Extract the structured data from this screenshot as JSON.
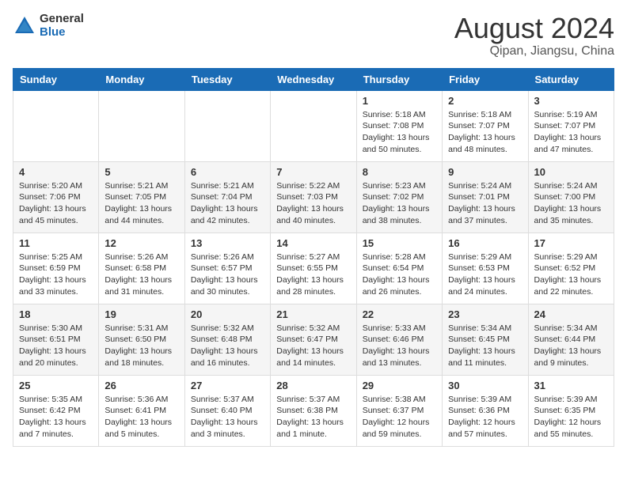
{
  "logo": {
    "general": "General",
    "blue": "Blue"
  },
  "title": {
    "month_year": "August 2024",
    "location": "Qipan, Jiangsu, China"
  },
  "days_of_week": [
    "Sunday",
    "Monday",
    "Tuesday",
    "Wednesday",
    "Thursday",
    "Friday",
    "Saturday"
  ],
  "weeks": [
    [
      {
        "day": "",
        "info": ""
      },
      {
        "day": "",
        "info": ""
      },
      {
        "day": "",
        "info": ""
      },
      {
        "day": "",
        "info": ""
      },
      {
        "day": "1",
        "info": "Sunrise: 5:18 AM\nSunset: 7:08 PM\nDaylight: 13 hours\nand 50 minutes."
      },
      {
        "day": "2",
        "info": "Sunrise: 5:18 AM\nSunset: 7:07 PM\nDaylight: 13 hours\nand 48 minutes."
      },
      {
        "day": "3",
        "info": "Sunrise: 5:19 AM\nSunset: 7:07 PM\nDaylight: 13 hours\nand 47 minutes."
      }
    ],
    [
      {
        "day": "4",
        "info": "Sunrise: 5:20 AM\nSunset: 7:06 PM\nDaylight: 13 hours\nand 45 minutes."
      },
      {
        "day": "5",
        "info": "Sunrise: 5:21 AM\nSunset: 7:05 PM\nDaylight: 13 hours\nand 44 minutes."
      },
      {
        "day": "6",
        "info": "Sunrise: 5:21 AM\nSunset: 7:04 PM\nDaylight: 13 hours\nand 42 minutes."
      },
      {
        "day": "7",
        "info": "Sunrise: 5:22 AM\nSunset: 7:03 PM\nDaylight: 13 hours\nand 40 minutes."
      },
      {
        "day": "8",
        "info": "Sunrise: 5:23 AM\nSunset: 7:02 PM\nDaylight: 13 hours\nand 38 minutes."
      },
      {
        "day": "9",
        "info": "Sunrise: 5:24 AM\nSunset: 7:01 PM\nDaylight: 13 hours\nand 37 minutes."
      },
      {
        "day": "10",
        "info": "Sunrise: 5:24 AM\nSunset: 7:00 PM\nDaylight: 13 hours\nand 35 minutes."
      }
    ],
    [
      {
        "day": "11",
        "info": "Sunrise: 5:25 AM\nSunset: 6:59 PM\nDaylight: 13 hours\nand 33 minutes."
      },
      {
        "day": "12",
        "info": "Sunrise: 5:26 AM\nSunset: 6:58 PM\nDaylight: 13 hours\nand 31 minutes."
      },
      {
        "day": "13",
        "info": "Sunrise: 5:26 AM\nSunset: 6:57 PM\nDaylight: 13 hours\nand 30 minutes."
      },
      {
        "day": "14",
        "info": "Sunrise: 5:27 AM\nSunset: 6:55 PM\nDaylight: 13 hours\nand 28 minutes."
      },
      {
        "day": "15",
        "info": "Sunrise: 5:28 AM\nSunset: 6:54 PM\nDaylight: 13 hours\nand 26 minutes."
      },
      {
        "day": "16",
        "info": "Sunrise: 5:29 AM\nSunset: 6:53 PM\nDaylight: 13 hours\nand 24 minutes."
      },
      {
        "day": "17",
        "info": "Sunrise: 5:29 AM\nSunset: 6:52 PM\nDaylight: 13 hours\nand 22 minutes."
      }
    ],
    [
      {
        "day": "18",
        "info": "Sunrise: 5:30 AM\nSunset: 6:51 PM\nDaylight: 13 hours\nand 20 minutes."
      },
      {
        "day": "19",
        "info": "Sunrise: 5:31 AM\nSunset: 6:50 PM\nDaylight: 13 hours\nand 18 minutes."
      },
      {
        "day": "20",
        "info": "Sunrise: 5:32 AM\nSunset: 6:48 PM\nDaylight: 13 hours\nand 16 minutes."
      },
      {
        "day": "21",
        "info": "Sunrise: 5:32 AM\nSunset: 6:47 PM\nDaylight: 13 hours\nand 14 minutes."
      },
      {
        "day": "22",
        "info": "Sunrise: 5:33 AM\nSunset: 6:46 PM\nDaylight: 13 hours\nand 13 minutes."
      },
      {
        "day": "23",
        "info": "Sunrise: 5:34 AM\nSunset: 6:45 PM\nDaylight: 13 hours\nand 11 minutes."
      },
      {
        "day": "24",
        "info": "Sunrise: 5:34 AM\nSunset: 6:44 PM\nDaylight: 13 hours\nand 9 minutes."
      }
    ],
    [
      {
        "day": "25",
        "info": "Sunrise: 5:35 AM\nSunset: 6:42 PM\nDaylight: 13 hours\nand 7 minutes."
      },
      {
        "day": "26",
        "info": "Sunrise: 5:36 AM\nSunset: 6:41 PM\nDaylight: 13 hours\nand 5 minutes."
      },
      {
        "day": "27",
        "info": "Sunrise: 5:37 AM\nSunset: 6:40 PM\nDaylight: 13 hours\nand 3 minutes."
      },
      {
        "day": "28",
        "info": "Sunrise: 5:37 AM\nSunset: 6:38 PM\nDaylight: 13 hours\nand 1 minute."
      },
      {
        "day": "29",
        "info": "Sunrise: 5:38 AM\nSunset: 6:37 PM\nDaylight: 12 hours\nand 59 minutes."
      },
      {
        "day": "30",
        "info": "Sunrise: 5:39 AM\nSunset: 6:36 PM\nDaylight: 12 hours\nand 57 minutes."
      },
      {
        "day": "31",
        "info": "Sunrise: 5:39 AM\nSunset: 6:35 PM\nDaylight: 12 hours\nand 55 minutes."
      }
    ]
  ]
}
